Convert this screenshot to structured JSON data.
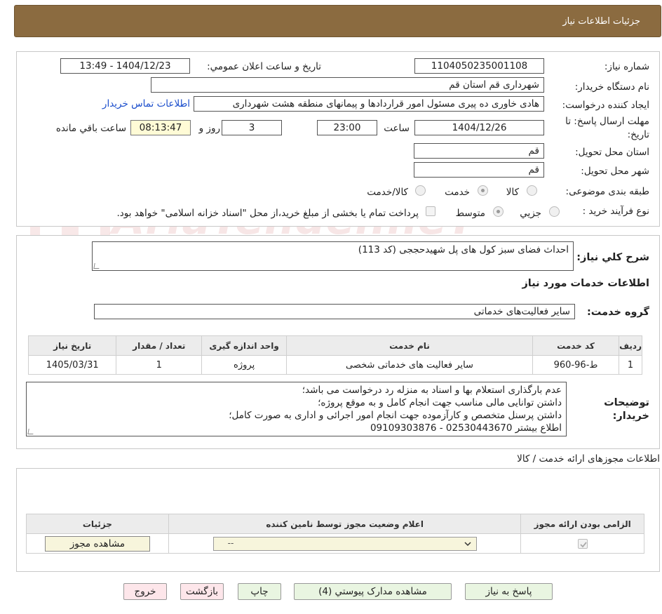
{
  "header": {
    "title": "جزئیات اطلاعات نیاز"
  },
  "form": {
    "need_number_label": "شماره نیاز:",
    "need_number": "1104050235001108",
    "announce_label": "تاریخ و ساعت اعلان عمومي:",
    "announce_value": "1404/12/23 - 13:49",
    "buyer_org_label": "نام دستگاه خریدار:",
    "buyer_org": "شهرداری قم استان قم",
    "creator_label": "ایجاد کننده درخواست:",
    "creator": "هادی خاوری ده پیری مسئول امور قراردادها و پیمانهای منطقه هشت شهرداری",
    "contact_link": "اطلاعات تماس خریدار",
    "deadline_label_1": "مهلت ارسال پاسخ: تا",
    "deadline_label_2": "تاریخ:",
    "deadline_date": "1404/12/26",
    "time_label": "ساعت",
    "deadline_time": "23:00",
    "days_value": "3",
    "days_label": "روز و",
    "remaining_time": "08:13:47",
    "remaining_label": "ساعت باقي مانده",
    "province_label": "استان محل تحویل:",
    "province": "قم",
    "city_label": "شهر محل تحویل:",
    "city": "قم",
    "category_label": "طبقه بندی موضوعی:",
    "category_options": [
      "کالا",
      "خدمت",
      "کالا/خدمت"
    ],
    "category_selected": "خدمت",
    "process_label": "نوع فرآیند خرید :",
    "process_options": [
      "جزيي",
      "متوسط"
    ],
    "process_selected": "متوسط",
    "payment_note": "پرداخت تمام یا بخشی از مبلغ خرید،از محل \"اسناد خزانه اسلامی\" خواهد بود."
  },
  "summary": {
    "label": "شرح کلي نیاز:",
    "value": "احداث فضای سبز کول های پل شهیدحججی (کد 113)"
  },
  "services": {
    "section_title": "اطلاعات خدمات مورد نیاز",
    "group_label": "گروه خدمت:",
    "group_value": "سایر فعالیت‌های خدماتی",
    "columns": [
      "ردیف",
      "کد خدمت",
      "نام خدمت",
      "واحد اندازه گیری",
      "تعداد / مقدار",
      "تاریخ نیاز"
    ],
    "rows": [
      {
        "row": "1",
        "code": "ط-96-960",
        "name": "سایر فعالیت های خدماتی شخصی",
        "unit": "پروژه",
        "qty": "1",
        "date": "1405/03/31"
      }
    ]
  },
  "buyer_notes": {
    "label_1": "توضیحات",
    "label_2": "خریدار:",
    "lines": [
      "عدم بارگذاری استعلام بها و اسناد به منزله رد درخواست می باشد؛",
      "داشتن توانایی مالی مناسب جهت انجام کامل و به موقع پروژه؛",
      "داشتن پرسنل متخصص و کارآزموده جهت انجام امور اجرائی و اداری به صورت کامل؛",
      "اطلاع بیشتر 02530443670 - 09109303876"
    ]
  },
  "permits": {
    "section_title": "اطلاعات مجوزهای ارائه خدمت / کالا",
    "columns": [
      "الزامی بودن ارائه مجوز",
      "اعلام وضعیت مجوز توسط نامین کننده",
      "جزئیات"
    ],
    "select_value": "--",
    "view_button": "مشاهده مجوز"
  },
  "buttons": {
    "reply": "پاسخ به نیاز",
    "attachments": "مشاهده مدارک پیوستي (4)",
    "print": "چاپ",
    "back": "بازگشت",
    "exit": "خروج"
  },
  "colors": {
    "header_bg": "#8b6b40",
    "link": "#1a4dcc",
    "green_button": "#e9f5e1",
    "pink_button": "#fde6ea",
    "yellow_field": "#fffbd6"
  },
  "icons": {
    "watermark": "ariatender-logo",
    "check": "check-icon",
    "dropdown": "chevron-down-icon"
  }
}
